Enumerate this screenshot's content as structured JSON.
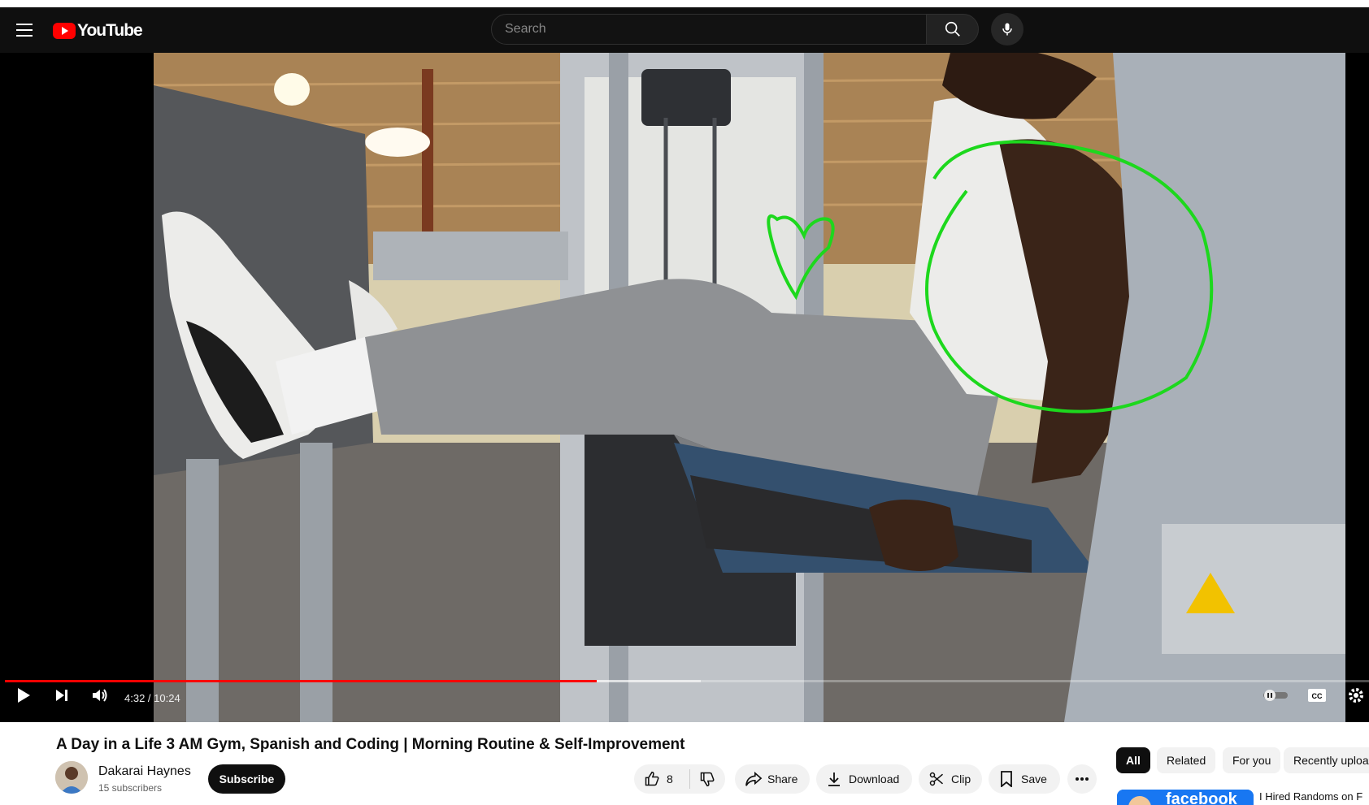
{
  "header": {
    "logo_text": "YouTube",
    "search_placeholder": "Search"
  },
  "player": {
    "time_display": "4:32 / 10:24",
    "progress_fraction": 0.434,
    "buffer_fraction": 0.51,
    "accent_color": "#ff0000"
  },
  "video": {
    "title": "A Day in a Life 3 AM Gym, Spanish and Coding | Morning Routine & Self-Improvement",
    "channel_name": "Dakarai Haynes",
    "subscribers": "15 subscribers",
    "subscribe_label": "Subscribe"
  },
  "actions": {
    "like_count": "8",
    "share_label": "Share",
    "download_label": "Download",
    "clip_label": "Clip",
    "save_label": "Save"
  },
  "chips": [
    "All",
    "Related",
    "For you",
    "Recently uploa"
  ],
  "recommendation": {
    "thumb_text": "facebook",
    "title": "I Hired Randoms on F"
  },
  "icons": {
    "menu": "hamburger-icon",
    "search": "search-icon",
    "mic": "microphone-icon",
    "play": "play-icon",
    "next": "skip-next-icon",
    "volume": "volume-icon",
    "autoplay": "autoplay-toggle-icon",
    "captions": "captions-icon",
    "settings": "gear-icon",
    "like": "thumbs-up-icon",
    "dislike": "thumbs-down-icon",
    "share": "share-icon",
    "download": "download-icon",
    "clip": "scissors-icon",
    "save": "bookmark-icon",
    "more": "more-horizontal-icon"
  }
}
